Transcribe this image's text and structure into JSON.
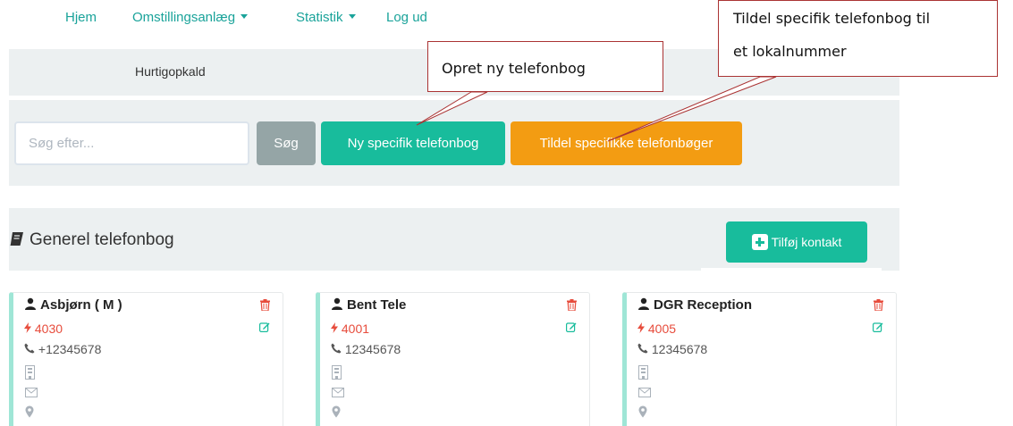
{
  "nav": {
    "home": "Hjem",
    "switchboard": "Omstillingsanlæg",
    "statistics": "Statistik",
    "logout": "Log ud"
  },
  "quick_dial": "Hurtigopkald",
  "search": {
    "placeholder": "Søg efter...",
    "button": "Søg"
  },
  "actions": {
    "new_book": "Ny specifik telefonbog",
    "assign_books": "Tildel specifikke telefonbøger"
  },
  "general_book": {
    "title": "Generel telefonbog",
    "add_contact": "Tilføj kontakt"
  },
  "contacts": [
    {
      "name": "Asbjørn ( M )",
      "extension": "4030",
      "phone": "+12345678"
    },
    {
      "name": "Bent Tele",
      "extension": "4001",
      "phone": "12345678"
    },
    {
      "name": "DGR Reception",
      "extension": "4005",
      "phone": "12345678"
    }
  ],
  "callouts": {
    "new_book": "Opret ny telefonbog",
    "assign_line1": "Tildel specifik telefonbog til",
    "assign_line2": "et lokalnummer"
  },
  "colors": {
    "accent": "#18bc9c",
    "warning": "#f39c12",
    "danger": "#e74c3c",
    "muted_button": "#95a5a6",
    "panel": "#ecf0f1",
    "callout_border": "#aa3333"
  }
}
